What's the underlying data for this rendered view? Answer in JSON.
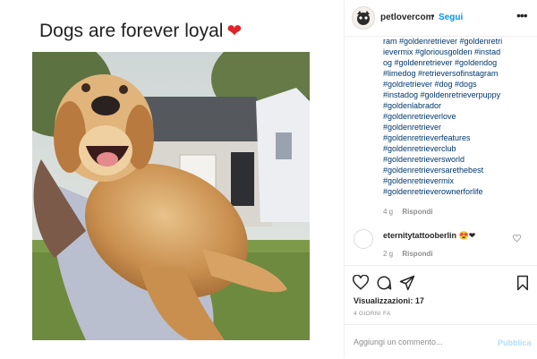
{
  "media": {
    "caption_title": "Dogs are forever loyal",
    "heart_glyph": "❤",
    "heart_color": "#e0242c"
  },
  "post": {
    "username": "petlovercom",
    "separator": "•",
    "follow_label": "Segui",
    "follow_color": "#0095f6",
    "more_label": "•••",
    "hashtags": [
      "ram #goldenretriever #goldenretri",
      "ievermix #gloriousgolden #instad",
      "og #goldenretriever #goldendog",
      "#limedog #retrieversofinstagram",
      "#goldretriever #dog #dogs",
      "#instadog #goldenretrieverpuppy",
      "#goldenlabrador",
      "#goldenretrieverlove",
      "#goldenretriever",
      "#goldenretrieverfeatures",
      "#goldenretrieverclub",
      "#goldenretrieversworld",
      "#goldenretrieversarethebest",
      "#goldenretrievermix",
      "#goldenretrieverownerforlife"
    ],
    "caption_age": "4 g",
    "reply_label": "Rispondi"
  },
  "comment": {
    "username": "eternitytattooberlin",
    "text": "😍❤",
    "age": "2 g",
    "reply_label": "Rispondi"
  },
  "actions": {
    "views_label": "Visualizzazioni: 17",
    "time_ago": "4 GIORNI FA"
  },
  "comment_box": {
    "placeholder": "Aggiungi un commento...",
    "publish_label": "Pubblica"
  },
  "icons": [
    "heart-outline-icon",
    "comment-icon",
    "share-icon",
    "bookmark-icon",
    "like-comment-icon",
    "more-options-icon"
  ]
}
